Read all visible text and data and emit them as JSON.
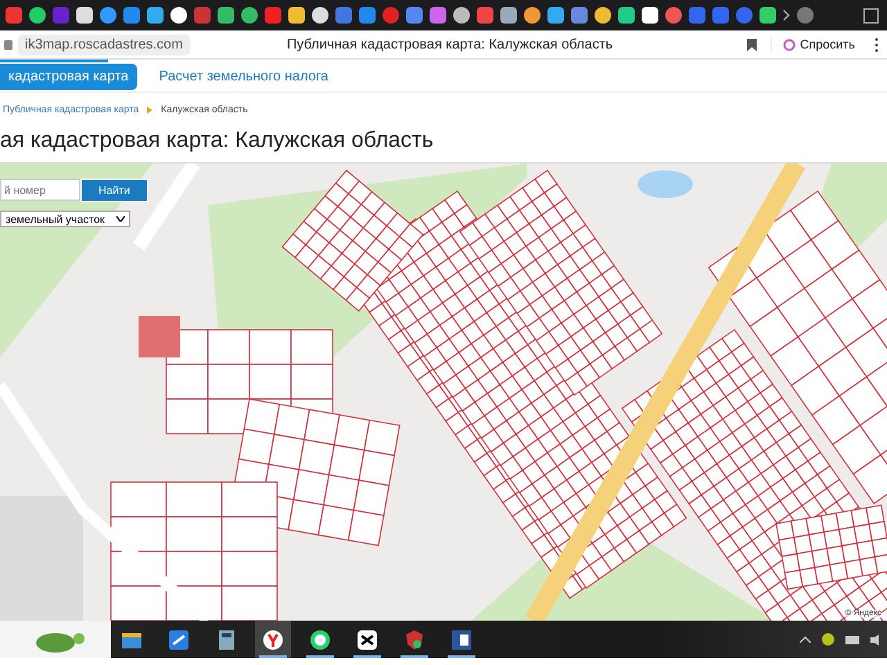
{
  "address_bar": {
    "url": "ik3map.roscadastres.com",
    "page_title": "Публичная кадастровая карта: Калужская область",
    "ask_button": "Спросить"
  },
  "nav_tabs": [
    {
      "label": "кадастровая карта",
      "selected": true
    },
    {
      "label": "Расчет земельного налога",
      "selected": false
    }
  ],
  "breadcrumb": {
    "link": "Публичная кадастровая карта",
    "current": "Калужская область"
  },
  "heading": "ая кадастровая карта: Калужская область",
  "map": {
    "search": {
      "placeholder": "й номер",
      "button": "Найти"
    },
    "object_type": "земельный участок",
    "attribution": "© Яндекс"
  },
  "taskbar": {
    "apps": [
      {
        "kind": "folder",
        "selected": false,
        "running": false
      },
      {
        "kind": "scanner",
        "selected": false,
        "running": false
      },
      {
        "kind": "calculator",
        "selected": false,
        "running": false
      },
      {
        "kind": "browser",
        "selected": true,
        "running": true
      },
      {
        "kind": "whatsapp",
        "selected": false,
        "running": true
      },
      {
        "kind": "capcut",
        "selected": false,
        "running": true
      },
      {
        "kind": "shield",
        "selected": false,
        "running": true
      },
      {
        "kind": "word",
        "selected": false,
        "running": true
      }
    ]
  }
}
